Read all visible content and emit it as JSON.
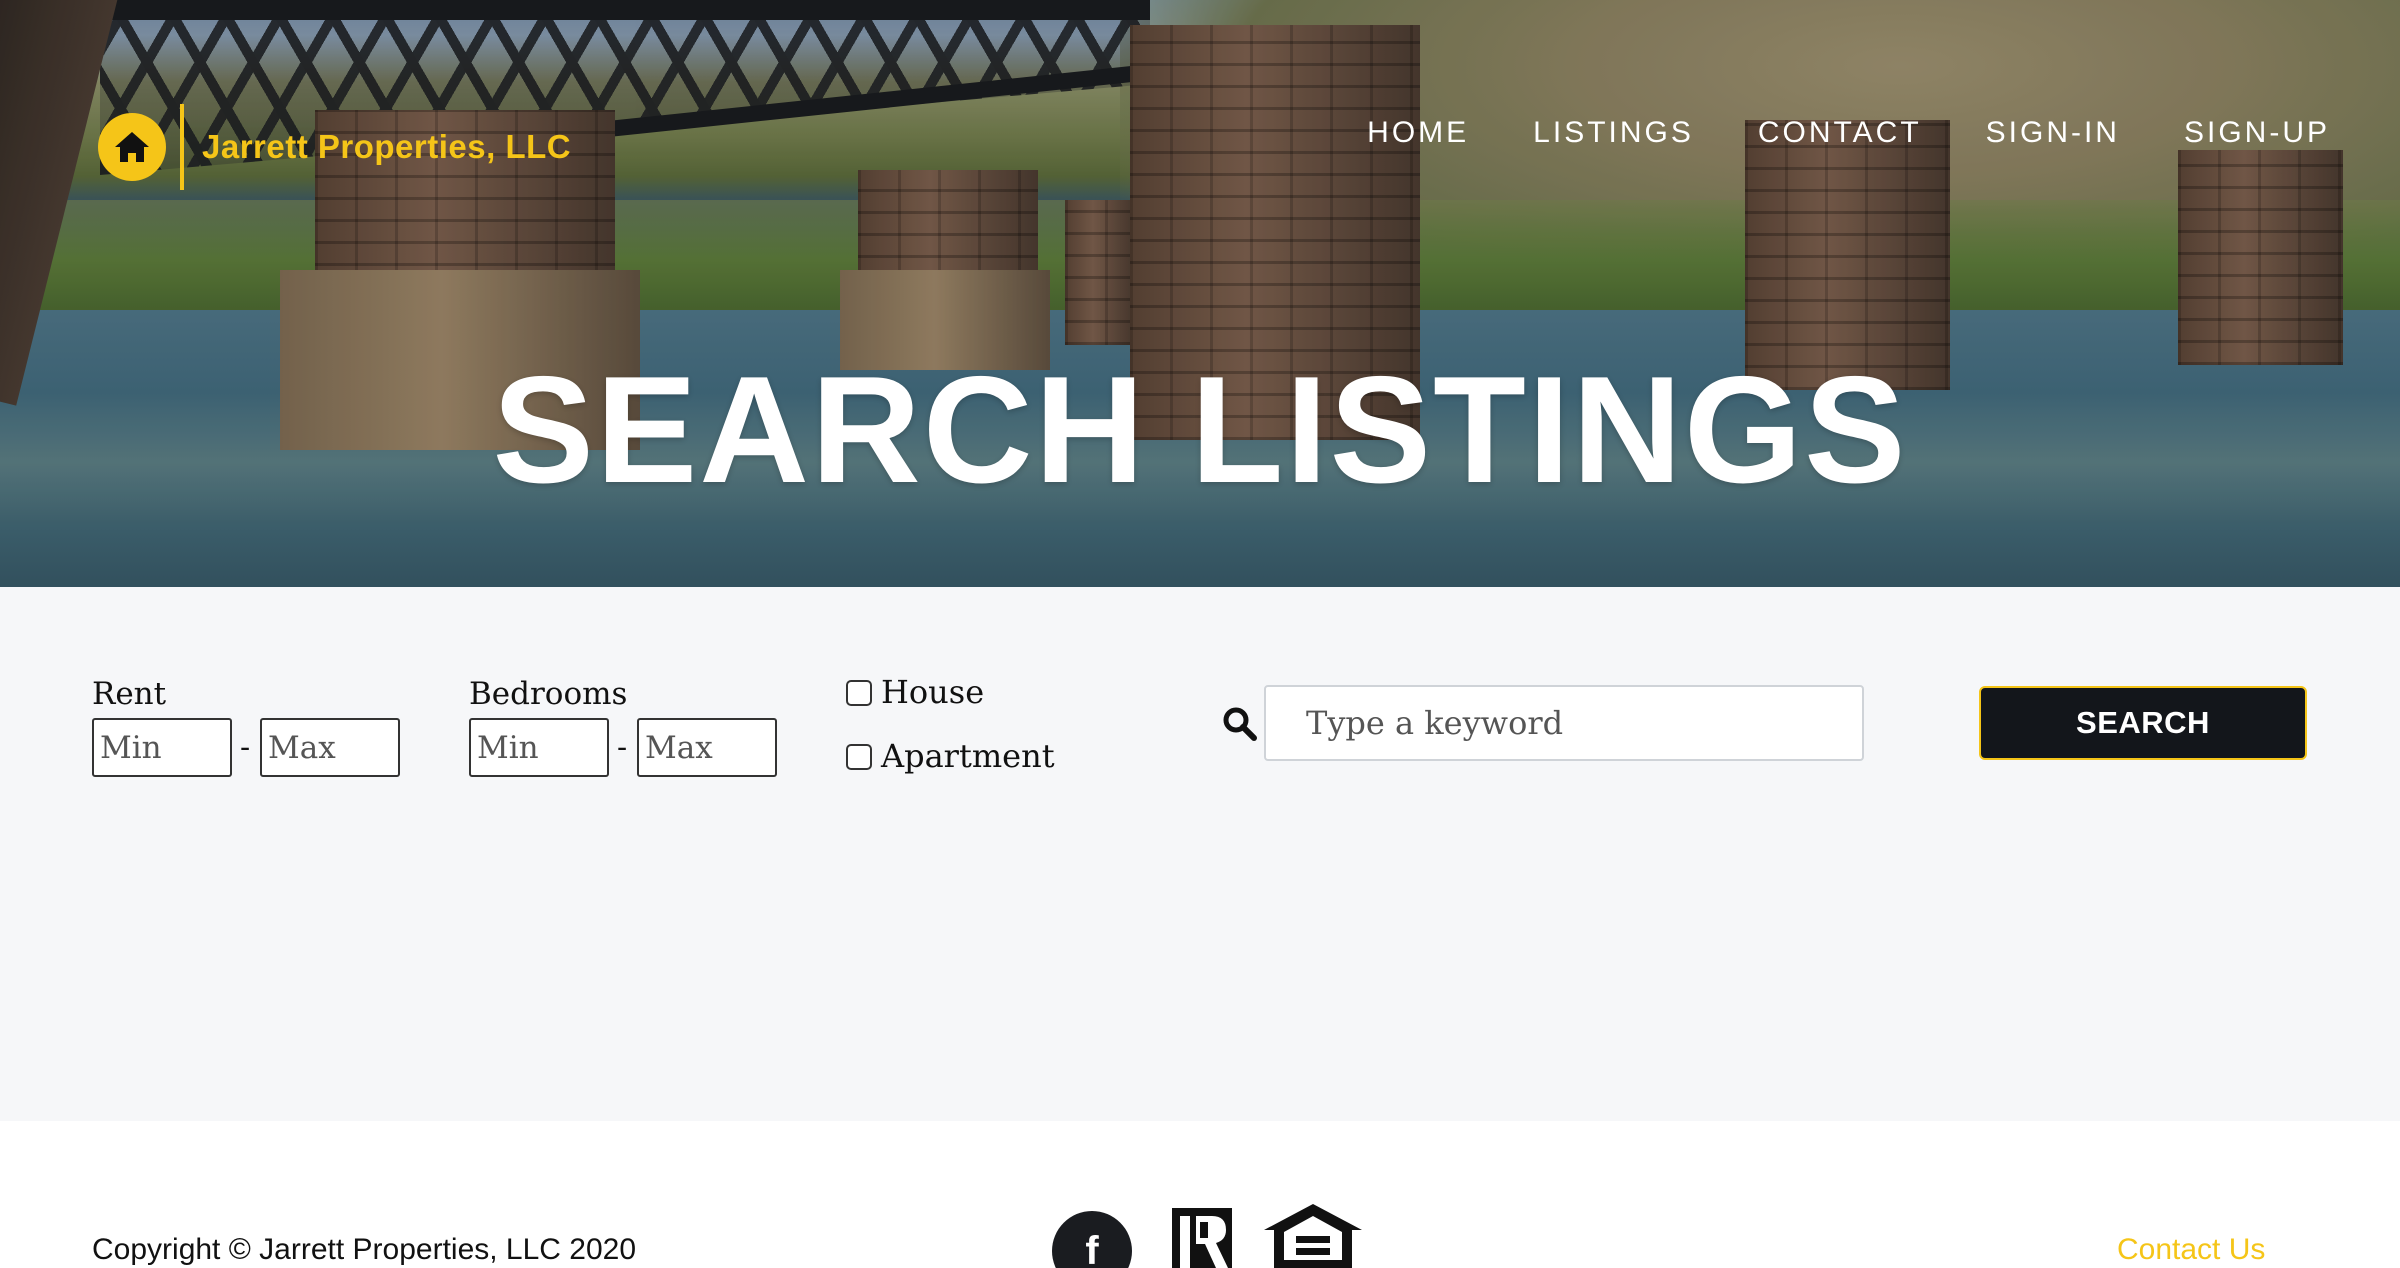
{
  "brand": {
    "name": "Jarrett Properties, LLC",
    "accent_color": "#f5c518",
    "logo_icon": "house-icon"
  },
  "nav": {
    "items": [
      {
        "label": "HOME"
      },
      {
        "label": "LISTINGS"
      },
      {
        "label": "CONTACT"
      },
      {
        "label": "SIGN-IN"
      },
      {
        "label": "SIGN-UP"
      }
    ]
  },
  "hero": {
    "title": "SEARCH LISTINGS"
  },
  "filters": {
    "rent": {
      "label": "Rent",
      "min_placeholder": "Min",
      "max_placeholder": "Max",
      "separator": "-"
    },
    "bedrooms": {
      "label": "Bedrooms",
      "min_placeholder": "Min",
      "max_placeholder": "Max",
      "separator": "-"
    },
    "types": [
      {
        "label": "House",
        "checked": false
      },
      {
        "label": "Apartment",
        "checked": false
      }
    ],
    "keyword": {
      "placeholder": "Type a keyword",
      "icon": "search-icon"
    },
    "search_button": "SEARCH"
  },
  "footer": {
    "copyright": "Copyright © Jarrett Properties, LLC 2020",
    "facebook_letter": "f",
    "icons": [
      "facebook-icon",
      "realtor-icon",
      "equal-housing-icon"
    ],
    "contact_link": "Contact Us"
  }
}
